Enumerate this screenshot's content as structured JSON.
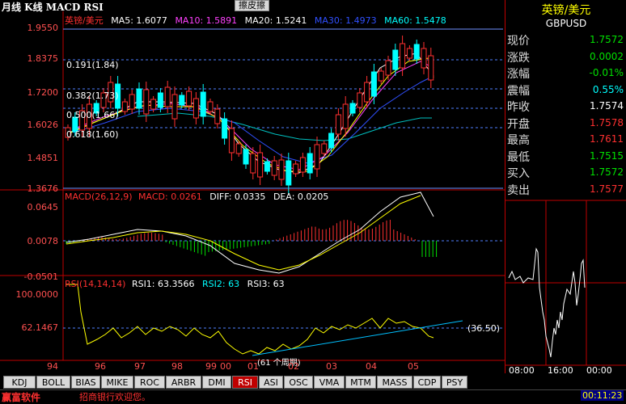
{
  "title_bar": {
    "chart_title": "月线 K线 MACD RSI",
    "eraser_button": "擦皮擦"
  },
  "kline_legend": {
    "symbol": "英镑/美元",
    "ma5": "MA5: 1.6077",
    "ma10": "MA10: 1.5891",
    "ma20": "MA20: 1.5241",
    "ma30": "MA30: 1.4973",
    "ma60": "MA60: 1.5478"
  },
  "kline_axis": [
    "1.9550",
    "1.8375",
    "1.7200",
    "1.6026",
    "1.4851",
    "1.3676"
  ],
  "fib_labels": [
    "0.191(1.84)",
    "0.382(1.73)",
    "0.500(1.66)",
    "0.618(1.60)"
  ],
  "macd_legend": {
    "name": "MACD(26,12,9)",
    "macd": "MACD: 0.0261",
    "diff": "DIFF: 0.0335",
    "dea": "DEA: 0.0205"
  },
  "macd_axis": [
    "0.0645",
    "0.0078",
    "-0.0501"
  ],
  "rsi_legend": {
    "name": "RSI(14,14,14)",
    "rsi1": "RSI1: 63.3566",
    "rsi2": "RSI2: 63",
    "rsi3": "RSI3: 63"
  },
  "rsi_axis": [
    "100.0000",
    "62.1467"
  ],
  "rsi_annotations": {
    "trend_value": "(36.50)",
    "lower_note": "(61 个周期)"
  },
  "x_axis": [
    "94",
    "96",
    "97",
    "98",
    "99",
    "00",
    "01",
    "02",
    "03",
    "04",
    "05"
  ],
  "right_panel": {
    "name": "英镑/美元",
    "code": "GBPUSD",
    "rows": [
      {
        "label": "现价",
        "value": "1.7572",
        "color": "#00e000"
      },
      {
        "label": "涨跌",
        "value": "0.0002",
        "color": "#00e000"
      },
      {
        "label": "涨幅",
        "value": "-0.01%",
        "color": "#00e000"
      },
      {
        "label": "震幅",
        "value": "0.55%",
        "color": "#00ffff"
      },
      {
        "label": "昨收",
        "value": "1.7574",
        "color": "#ffffff"
      },
      {
        "label": "开盘",
        "value": "1.7578",
        "color": "#ff3030"
      },
      {
        "label": "最高",
        "value": "1.7611",
        "color": "#ff3030"
      },
      {
        "label": "最低",
        "value": "1.7515",
        "color": "#00e000"
      },
      {
        "label": "买入",
        "value": "1.7572",
        "color": "#00e000"
      },
      {
        "label": "卖出",
        "value": "1.7577",
        "color": "#ff3030"
      }
    ],
    "time_axis": [
      "08:00",
      "16:00",
      "00:00"
    ]
  },
  "tabs": [
    "KDJ",
    "BOLL",
    "BIAS",
    "MIKE",
    "ROC",
    "ARBR",
    "DMI",
    "RSI",
    "ASI",
    "OSC",
    "VMA",
    "MTM",
    "MASS",
    "CDP",
    "PSY"
  ],
  "active_tab": "RSI",
  "status_bar": {
    "logo": "赢富软件",
    "message": "招商银行欢迎您。",
    "time": "00:11:23"
  }
}
